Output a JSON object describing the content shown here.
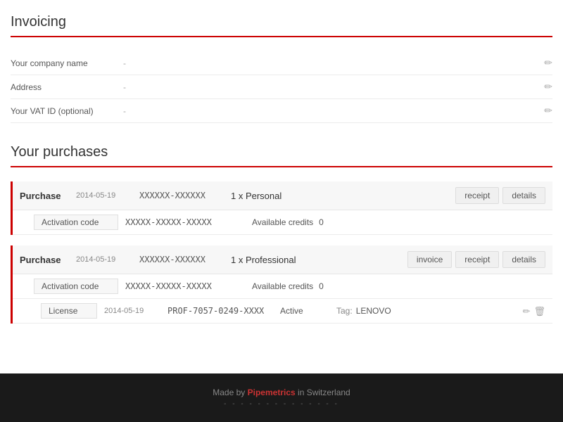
{
  "invoicing": {
    "title": "Invoicing",
    "fields": [
      {
        "label": "Your company name",
        "value": "-"
      },
      {
        "label": "Address",
        "value": "-"
      },
      {
        "label": "Your VAT ID (optional)",
        "value": "-"
      }
    ]
  },
  "purchases": {
    "title": "Your purchases",
    "items": [
      {
        "label": "Purchase",
        "date": "2014-05-19",
        "code": "XXXXXX-XXXXXX",
        "product": "1 x Personal",
        "actions": [
          "receipt",
          "details"
        ],
        "activation": {
          "label": "Activation code",
          "code": "XXXXX-XXXXX-XXXXX",
          "credits_label": "Available credits",
          "credits_value": "0"
        }
      },
      {
        "label": "Purchase",
        "date": "2014-05-19",
        "code": "XXXXXX-XXXXXX",
        "product": "1 x Professional",
        "actions": [
          "invoice",
          "receipt",
          "details"
        ],
        "activation": {
          "label": "Activation code",
          "code": "XXXXX-XXXXX-XXXXX",
          "credits_label": "Available credits",
          "credits_value": "0"
        },
        "license": {
          "label": "License",
          "date": "2014-05-19",
          "code": "PROF-7057-0249-XXXX",
          "status": "Active",
          "tag_label": "Tag:",
          "tag_value": "LENOVO"
        }
      }
    ]
  },
  "footer": {
    "text": "Made by",
    "brand": "Pipemetrics",
    "suffix": "in Switzerland",
    "dots": "- - - - - - - - - - - - - -"
  }
}
